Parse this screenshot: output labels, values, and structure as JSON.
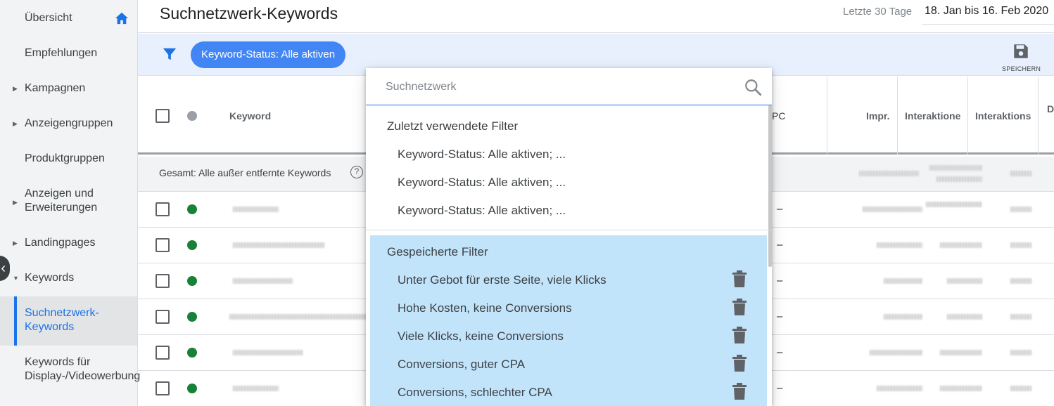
{
  "sidebar": {
    "items": [
      {
        "label": "Übersicht"
      },
      {
        "label": "Empfehlungen"
      },
      {
        "label": "Kampagnen"
      },
      {
        "label": "Anzeigengruppen"
      },
      {
        "label": "Produktgruppen"
      },
      {
        "label": "Anzeigen und Erweiterungen"
      },
      {
        "label": "Landingpages"
      },
      {
        "label": "Keywords"
      },
      {
        "label": "Suchnetzwerk-Keywords"
      },
      {
        "label": "Keywords für Display-/Videowerbung"
      }
    ],
    "collapse_icon": "chevron-left-icon"
  },
  "header": {
    "title": "Suchnetzwerk-Keywords",
    "date_label": "Letzte 30 Tage",
    "date_range": "18. Jan bis 16. Feb 2020"
  },
  "filterbar": {
    "chip_label": "Keyword-Status: Alle aktiven",
    "save_label": "SPEICHERN"
  },
  "table": {
    "columns": {
      "keyword": "Keyword",
      "cpc": "PC",
      "impr": "Impr.",
      "interactions": "Interaktione",
      "interaction_rate": "Interaktions",
      "next": "D"
    },
    "total_label": "Gesamt: Alle außer entfernte Keywords",
    "row_count": 6,
    "dash": "–"
  },
  "dropdown": {
    "search_placeholder": "Suchnetzwerk",
    "recent_title": "Zuletzt verwendete Filter",
    "recent": [
      "Keyword-Status: Alle aktiven; ...",
      "Keyword-Status: Alle aktiven; ...",
      "Keyword-Status: Alle aktiven; ..."
    ],
    "saved_title": "Gespeicherte Filter",
    "saved": [
      "Unter Gebot für erste Seite, viele Klicks",
      "Hohe Kosten, keine Conversions",
      "Viele Klicks, keine Conversions",
      "Conversions, guter CPA",
      "Conversions, schlechter CPA"
    ]
  },
  "colors": {
    "accent": "#1a73e8",
    "chip": "#4285f4",
    "filterbar_bg": "#e8f0fe",
    "saved_bg": "#c2e4fb",
    "status_green": "#188038"
  }
}
